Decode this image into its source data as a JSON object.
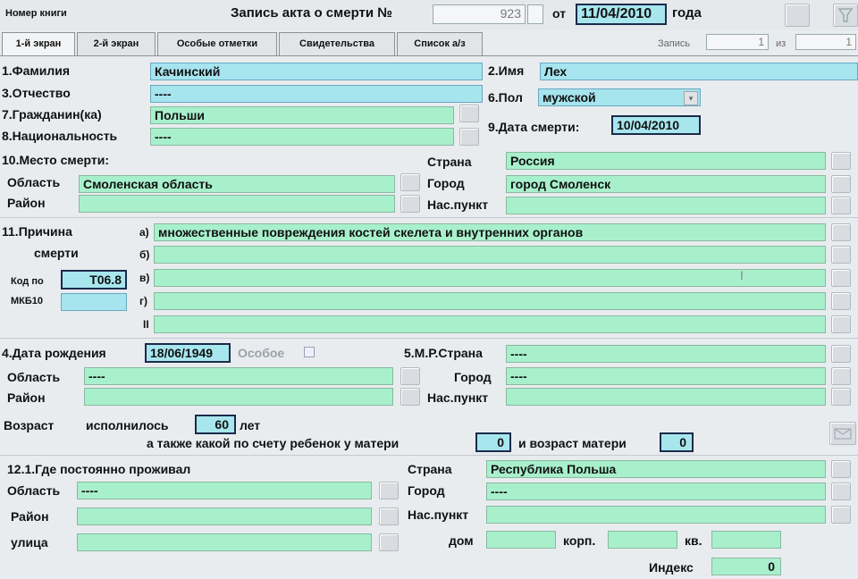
{
  "header": {
    "book_no_label": "Номер книги",
    "record_title": "Запись акта о  смерти №",
    "record_number": "923",
    "date_from_label": "от",
    "record_date": "11/04/2010",
    "year_label": "года",
    "record_label": "Запись",
    "record_index": "1",
    "of_label": "из",
    "record_total": "1"
  },
  "tabs": [
    {
      "label": "1-й экран"
    },
    {
      "label": "2-й экран"
    },
    {
      "label": "Особые отметки"
    },
    {
      "label": "Свидетельства"
    },
    {
      "label": "Список а/з"
    }
  ],
  "person": {
    "surname_label": "1.Фамилия",
    "surname": "Качинский",
    "name_label": "2.Имя",
    "name": "Лех",
    "patronymic_label": "3.Отчество",
    "patronymic": "----",
    "sex_label": "6.Пол",
    "sex": "мужской",
    "citizenship_label": "7.Гражданин(ка)",
    "citizenship": "Польши",
    "nationality_label": "8.Национальность",
    "nationality": "----",
    "death_date_label": "9.Дата смерти:",
    "death_date": "10/04/2010"
  },
  "death_place": {
    "title": "10.Место смерти:",
    "country_label": "Страна",
    "country": "Россия",
    "region_label": "Область",
    "region": "Смоленская область",
    "city_label": "Город",
    "city": "город Смоленск",
    "district_label": "Район",
    "district": "",
    "settlement_label": "Нас.пункт",
    "settlement": ""
  },
  "cause": {
    "title_1": "11.Причина",
    "title_2": "смерти",
    "code_label_1": "Код по",
    "code_label_2": "МКБ10",
    "code": "T06.8",
    "code_2": "",
    "rows": [
      {
        "letter": "а)",
        "text": "множественные повреждения костей скелета и внутренних органов"
      },
      {
        "letter": "б)",
        "text": ""
      },
      {
        "letter": "в)",
        "text": ""
      },
      {
        "letter": "г)",
        "text": ""
      },
      {
        "letter": "II",
        "text": ""
      }
    ]
  },
  "birth": {
    "date_label": "4.Дата рождения",
    "date": "18/06/1949",
    "special_label": "Особое",
    "country_label": "5.М.Р.Страна",
    "country": "----",
    "region_label": "Область",
    "region": "----",
    "city_label": "Город",
    "city": "----",
    "district_label": "Район",
    "district": "",
    "settlement_label": "Нас.пункт",
    "settlement": ""
  },
  "age": {
    "label": "Возраст",
    "turned_label": "исполнилось",
    "value": "60",
    "years_label": "лет",
    "child_order_label": "а также какой по счету ребенок у матери",
    "child_order": "0",
    "mother_age_label": "и возраст матери",
    "mother_age": "0"
  },
  "residence": {
    "title": "12.1.Где постоянно проживал",
    "country_label": "Страна",
    "country": "Республика Польша",
    "region_label": "Область",
    "region": "----",
    "city_label": "Город",
    "city": "----",
    "district_label": "Район",
    "district": "",
    "settlement_label": "Нас.пункт",
    "settlement": "",
    "street_label": "улица",
    "street": "",
    "house_label": "дом",
    "house": "",
    "building_label": "корп.",
    "building": "",
    "apt_label": "кв.",
    "apt": "",
    "index_label": "Индекс",
    "index": "0"
  },
  "colors": {
    "field_green": "#a8f0cc",
    "field_blue": "#a6e4ee",
    "background": "#e9ecef"
  }
}
